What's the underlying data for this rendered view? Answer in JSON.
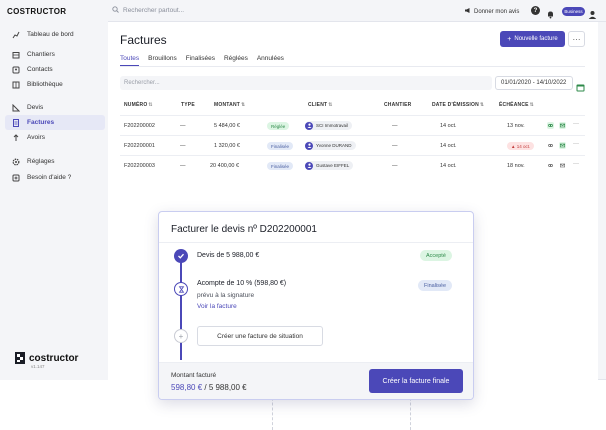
{
  "app": {
    "brand": "COSTRUCTOR",
    "footer_name": "costructor",
    "version": "v1.147"
  },
  "sidebar": {
    "items": [
      {
        "label": "Tableau de bord",
        "icon": "chart-icon"
      },
      {
        "label": "Chantiers",
        "icon": "building-icon"
      },
      {
        "label": "Contacts",
        "icon": "contacts-icon"
      },
      {
        "label": "Bibliothèque",
        "icon": "library-icon"
      },
      {
        "label": "Devis",
        "icon": "quote-icon"
      },
      {
        "label": "Factures",
        "icon": "invoice-icon",
        "active": true
      },
      {
        "label": "Avoirs",
        "icon": "credit-icon"
      },
      {
        "label": "Réglages",
        "icon": "gear-icon"
      },
      {
        "label": "Besoin d'aide ?",
        "icon": "help-plus-icon"
      }
    ]
  },
  "topbar": {
    "search_placeholder": "Rechercher partout...",
    "feedback": "Donner mon avis",
    "help": "?",
    "plan": "Business"
  },
  "page": {
    "title": "Factures",
    "new_button": "Nouvelle facture",
    "more": "···",
    "tabs": [
      "Toutes",
      "Brouillons",
      "Finalisées",
      "Réglées",
      "Annulées"
    ],
    "filter_placeholder": "Rechercher...",
    "date_range": "01/01/2020 - 14/10/2022"
  },
  "table": {
    "headers": {
      "numero": "NUMÉRO",
      "type": "TYPE",
      "montant": "MONTANT",
      "client": "CLIENT",
      "chantier": "CHANTIER",
      "emission": "DATE D'ÉMISSION",
      "echeance": "ÉCHÉANCE"
    },
    "rows": [
      {
        "numero": "F202200002",
        "type": "—",
        "montant": "5 484,00 €",
        "status": "Réglée",
        "client": "SCI Immotravail",
        "chantier": "—",
        "emission": "14 oct.",
        "echeance": "13 nov.",
        "late": false
      },
      {
        "numero": "F202200001",
        "type": "—",
        "montant": "1 320,00 €",
        "status": "Finalisée",
        "client": "Yvonne DURAND",
        "chantier": "—",
        "emission": "14 oct.",
        "echeance": "14 oct.",
        "late": true
      },
      {
        "numero": "F202200003",
        "type": "—",
        "montant": "20 400,00 €",
        "status": "Finalisée",
        "client": "Gustave EIFFEL",
        "chantier": "—",
        "emission": "14 oct.",
        "echeance": "18 nov.",
        "late": false
      }
    ],
    "row_more": "···"
  },
  "modal": {
    "title": "Facturer le devis nº D202200001",
    "step1": {
      "title": "Devis de 5 988,00 €",
      "badge": "Accepté"
    },
    "step2": {
      "title": "Acompte de 10 % (598,80 €)",
      "sub": "prévu à la signature",
      "link": "Voir la facture",
      "badge": "Finalisée"
    },
    "situation_button": "Créer une facture de situation",
    "footer": {
      "label": "Montant facturé",
      "billed": "598,80 €",
      "separator": " / ",
      "total": "5 988,00 €"
    },
    "final_button": "Créer la facture finale"
  },
  "colors": {
    "accent": "#4b48b8",
    "success_bg": "#dcf5e3",
    "success_fg": "#2e8a4a",
    "info_bg": "#e2e9f7",
    "danger_bg": "#fde2e2"
  }
}
